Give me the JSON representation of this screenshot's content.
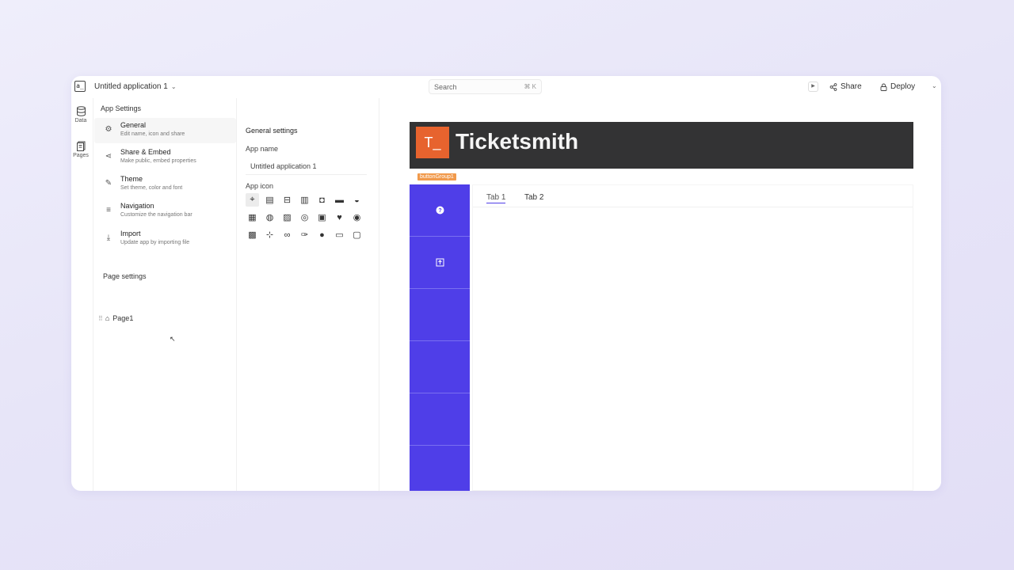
{
  "topbar": {
    "logo": "a_",
    "app_title": "Untitled application 1",
    "search_placeholder": "Search",
    "search_shortcut": "⌘ K",
    "share_label": "Share",
    "deploy_label": "Deploy"
  },
  "rail": {
    "data_label": "Data",
    "pages_label": "Pages"
  },
  "app_settings": {
    "title": "App Settings",
    "items": [
      {
        "label": "General",
        "desc": "Edit name, icon and share",
        "icon": "gear-icon"
      },
      {
        "label": "Share & Embed",
        "desc": "Make public, embed properties",
        "icon": "share-icon"
      },
      {
        "label": "Theme",
        "desc": "Set theme, color and font",
        "icon": "brush-icon"
      },
      {
        "label": "Navigation",
        "desc": "Customize the navigation bar",
        "icon": "menu-icon"
      },
      {
        "label": "Import",
        "desc": "Update app by importing file",
        "icon": "download-icon"
      }
    ],
    "page_settings_title": "Page settings",
    "page_name": "Page1"
  },
  "general_settings": {
    "title": "General settings",
    "app_name_label": "App name",
    "app_name_value": "Untitled application 1",
    "app_icon_label": "App icon"
  },
  "canvas": {
    "brand_badge": "T_",
    "brand_name": "Ticketsmith",
    "widget_tag": "buttonGroup1",
    "tabs": [
      "Tab 1",
      "Tab 2"
    ],
    "button_icons": [
      "question-icon",
      "upload-icon"
    ]
  },
  "colors": {
    "accent": "#4f3ee8",
    "brand_orange": "#e7632e",
    "header_dark": "#333334",
    "tag_orange": "#f19a4c"
  }
}
